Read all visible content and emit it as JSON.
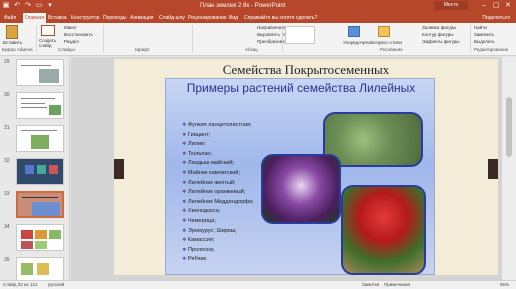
{
  "title_bar": {
    "document_title": "План землея 2 8х  -  PowerPoint",
    "account": "Место",
    "quick_access_icons": [
      "save-icon",
      "undo-icon",
      "redo-icon",
      "present-icon",
      "more-icon"
    ]
  },
  "tabs": {
    "items": [
      "Файл",
      "Главная",
      "Вставка",
      "Конструктор",
      "Переходы",
      "Анимация",
      "Слайд-шоу",
      "Рецензирование",
      "Вид",
      "Справка"
    ],
    "active": "Главная",
    "tell_me": "Что вы хотите сделать?",
    "share": "Поделиться"
  },
  "ribbon": {
    "paste": "Вставить",
    "clipboard_label": "Буфер обмена",
    "cut": "Макет",
    "reset": "Восстановить",
    "section": "Раздел",
    "new_slide": "Создать слайд",
    "slides_label": "Слайды",
    "font_label": "Шрифт",
    "paragraph_label": "Абзац",
    "text_direction": "Направление текста",
    "align_text": "Выровнять текст",
    "convert_smartart": "Преобразовать в SmartArt",
    "arrange": "Упорядочить",
    "quick_styles": "Экспресс-стили",
    "shape_fill": "Заливка фигуры",
    "shape_outline": "Контур фигуры",
    "shape_effects": "Эффекты фигуры",
    "drawing_label": "Рисование",
    "find": "Найти",
    "replace": "Заменить",
    "select": "Выделить",
    "editing_label": "Редактирование"
  },
  "thumbnails": {
    "numbers": [
      "29",
      "30",
      "31",
      "32",
      "33",
      "34",
      "35"
    ],
    "selected": "33"
  },
  "slide": {
    "title": "Семейства Покрытосеменных",
    "inner_title": "Примеры растений семейства Лилейных",
    "bullets": [
      "Функия ланцетолистная;",
      "Гиацинт;",
      "Лилия;",
      "Тюльпан;",
      "Ландыш майский;",
      "Майник камчатский;",
      "Лилейник желтый;",
      "Лилейник оранжевый;",
      "Лилейник Миддендорфа;",
      "Хионодокса;",
      "Чемерица;",
      "Эремурус; Ширяш;",
      "Камассия;",
      "Пролеска;",
      "Рябчик."
    ]
  },
  "status": {
    "slide_info": "Слайд 33 из 121",
    "language": "русский",
    "notes": "Заметки",
    "comments": "Примечания",
    "zoom": "55%"
  }
}
